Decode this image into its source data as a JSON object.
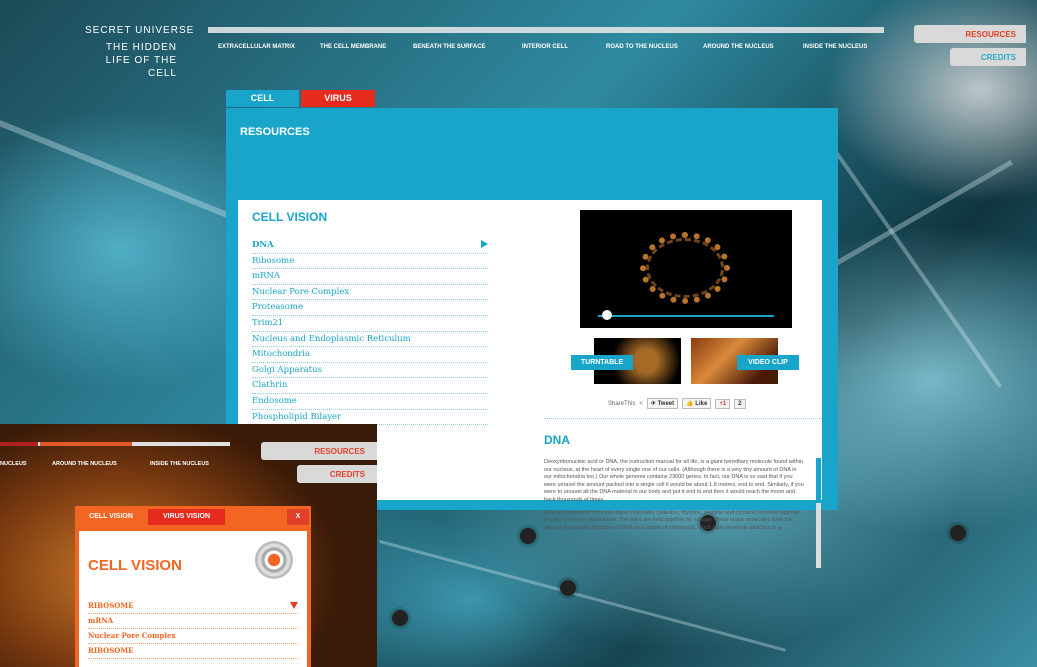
{
  "app": {
    "logo_line1": "SECRET UNIVERSE",
    "logo_line2": "THE HIDDEN LIFE OF THE CELL"
  },
  "nav": {
    "items": [
      {
        "label": "EXTRACELLULAR MATRIX"
      },
      {
        "label": "THE CELL MEMBRANE"
      },
      {
        "label": "BENEATH THE SURFACE"
      },
      {
        "label": "INTERIOR CELL"
      },
      {
        "label": "ROAD TO THE NUCLEUS"
      },
      {
        "label": "AROUND THE NUCLEUS"
      },
      {
        "label": "INSIDE THE NUCLEUS"
      }
    ],
    "progress_fraction": 0.0
  },
  "side": {
    "resources_label": "RESOURCES",
    "credits_label": "CREDITS"
  },
  "tabs": {
    "cell": "CELL",
    "virus": "VIRUS"
  },
  "panel": {
    "title": "RESOURCES",
    "section_title": "CELL VISION",
    "items": [
      {
        "label": "DNA"
      },
      {
        "label": "Ribosome"
      },
      {
        "label": "mRNA"
      },
      {
        "label": "Nuclear Pore Complex"
      },
      {
        "label": "Proteasome"
      },
      {
        "label": "Trim21"
      },
      {
        "label": "Nucleus and Endoplasmic Reticulum"
      },
      {
        "label": "Mitochondria"
      },
      {
        "label": "Golgi Apparatus"
      },
      {
        "label": "Clathrin"
      },
      {
        "label": "Endosome"
      },
      {
        "label": "Phospholipid Bilayer"
      }
    ],
    "turntable_label": "TURNTABLE",
    "videoclip_label": "VIDEO CLIP",
    "share": {
      "sharethis": "ShareThis",
      "tweet": "Tweet",
      "like": "Like",
      "gplus": "+1",
      "count": "2"
    },
    "detail_title": "DNA",
    "detail_paragraphs": [
      "Deoxyribonucleic acid or DNA, the instruction manual for all life, is a giant hereditary molecule found within our nucleus, at the heart of every single one of our cells. (Although there is a very tiny amount of DNA in our mitochondria too.) Our whole genome contains 23000 genes. In fact, our DNA is so vast that if you were unravel the amount packed into a single cell it would be about 1.8 metres, end to end. Similarly, if you were to unravel all the DNA material in our body and put it end to end then it would reach the moon and back thousands of times",
      "DNA is constructed from four base molecules, (adenine, thymine, guanine and cytosine) bonded together in pairs known as nucleotides. The pairs are held together by a sugar (these sugar molecules form the steps in the classic depiction of DNA as a ladder of chemicals). Each base molecule attaches to a"
    ]
  },
  "overlay": {
    "nav_items": [
      {
        "label": "NUCLEUS"
      },
      {
        "label": "AROUND THE NUCLEUS"
      },
      {
        "label": "INSIDE THE NUCLEUS"
      }
    ],
    "resources_label": "RESOURCES",
    "credits_label": "CREDITS",
    "tab_cell": "CELL VISION",
    "tab_virus": "VIRUS VISION",
    "close_label": "X",
    "title": "CELL VISION",
    "items": [
      {
        "label": "RIBOSOME"
      },
      {
        "label": "mRNA"
      },
      {
        "label": "Nuclear Pore Complex"
      },
      {
        "label": "RIBOSOME"
      }
    ]
  },
  "colors": {
    "accent_cyan": "#18a5c9",
    "accent_red": "#e62a1e",
    "accent_orange": "#f26522"
  }
}
